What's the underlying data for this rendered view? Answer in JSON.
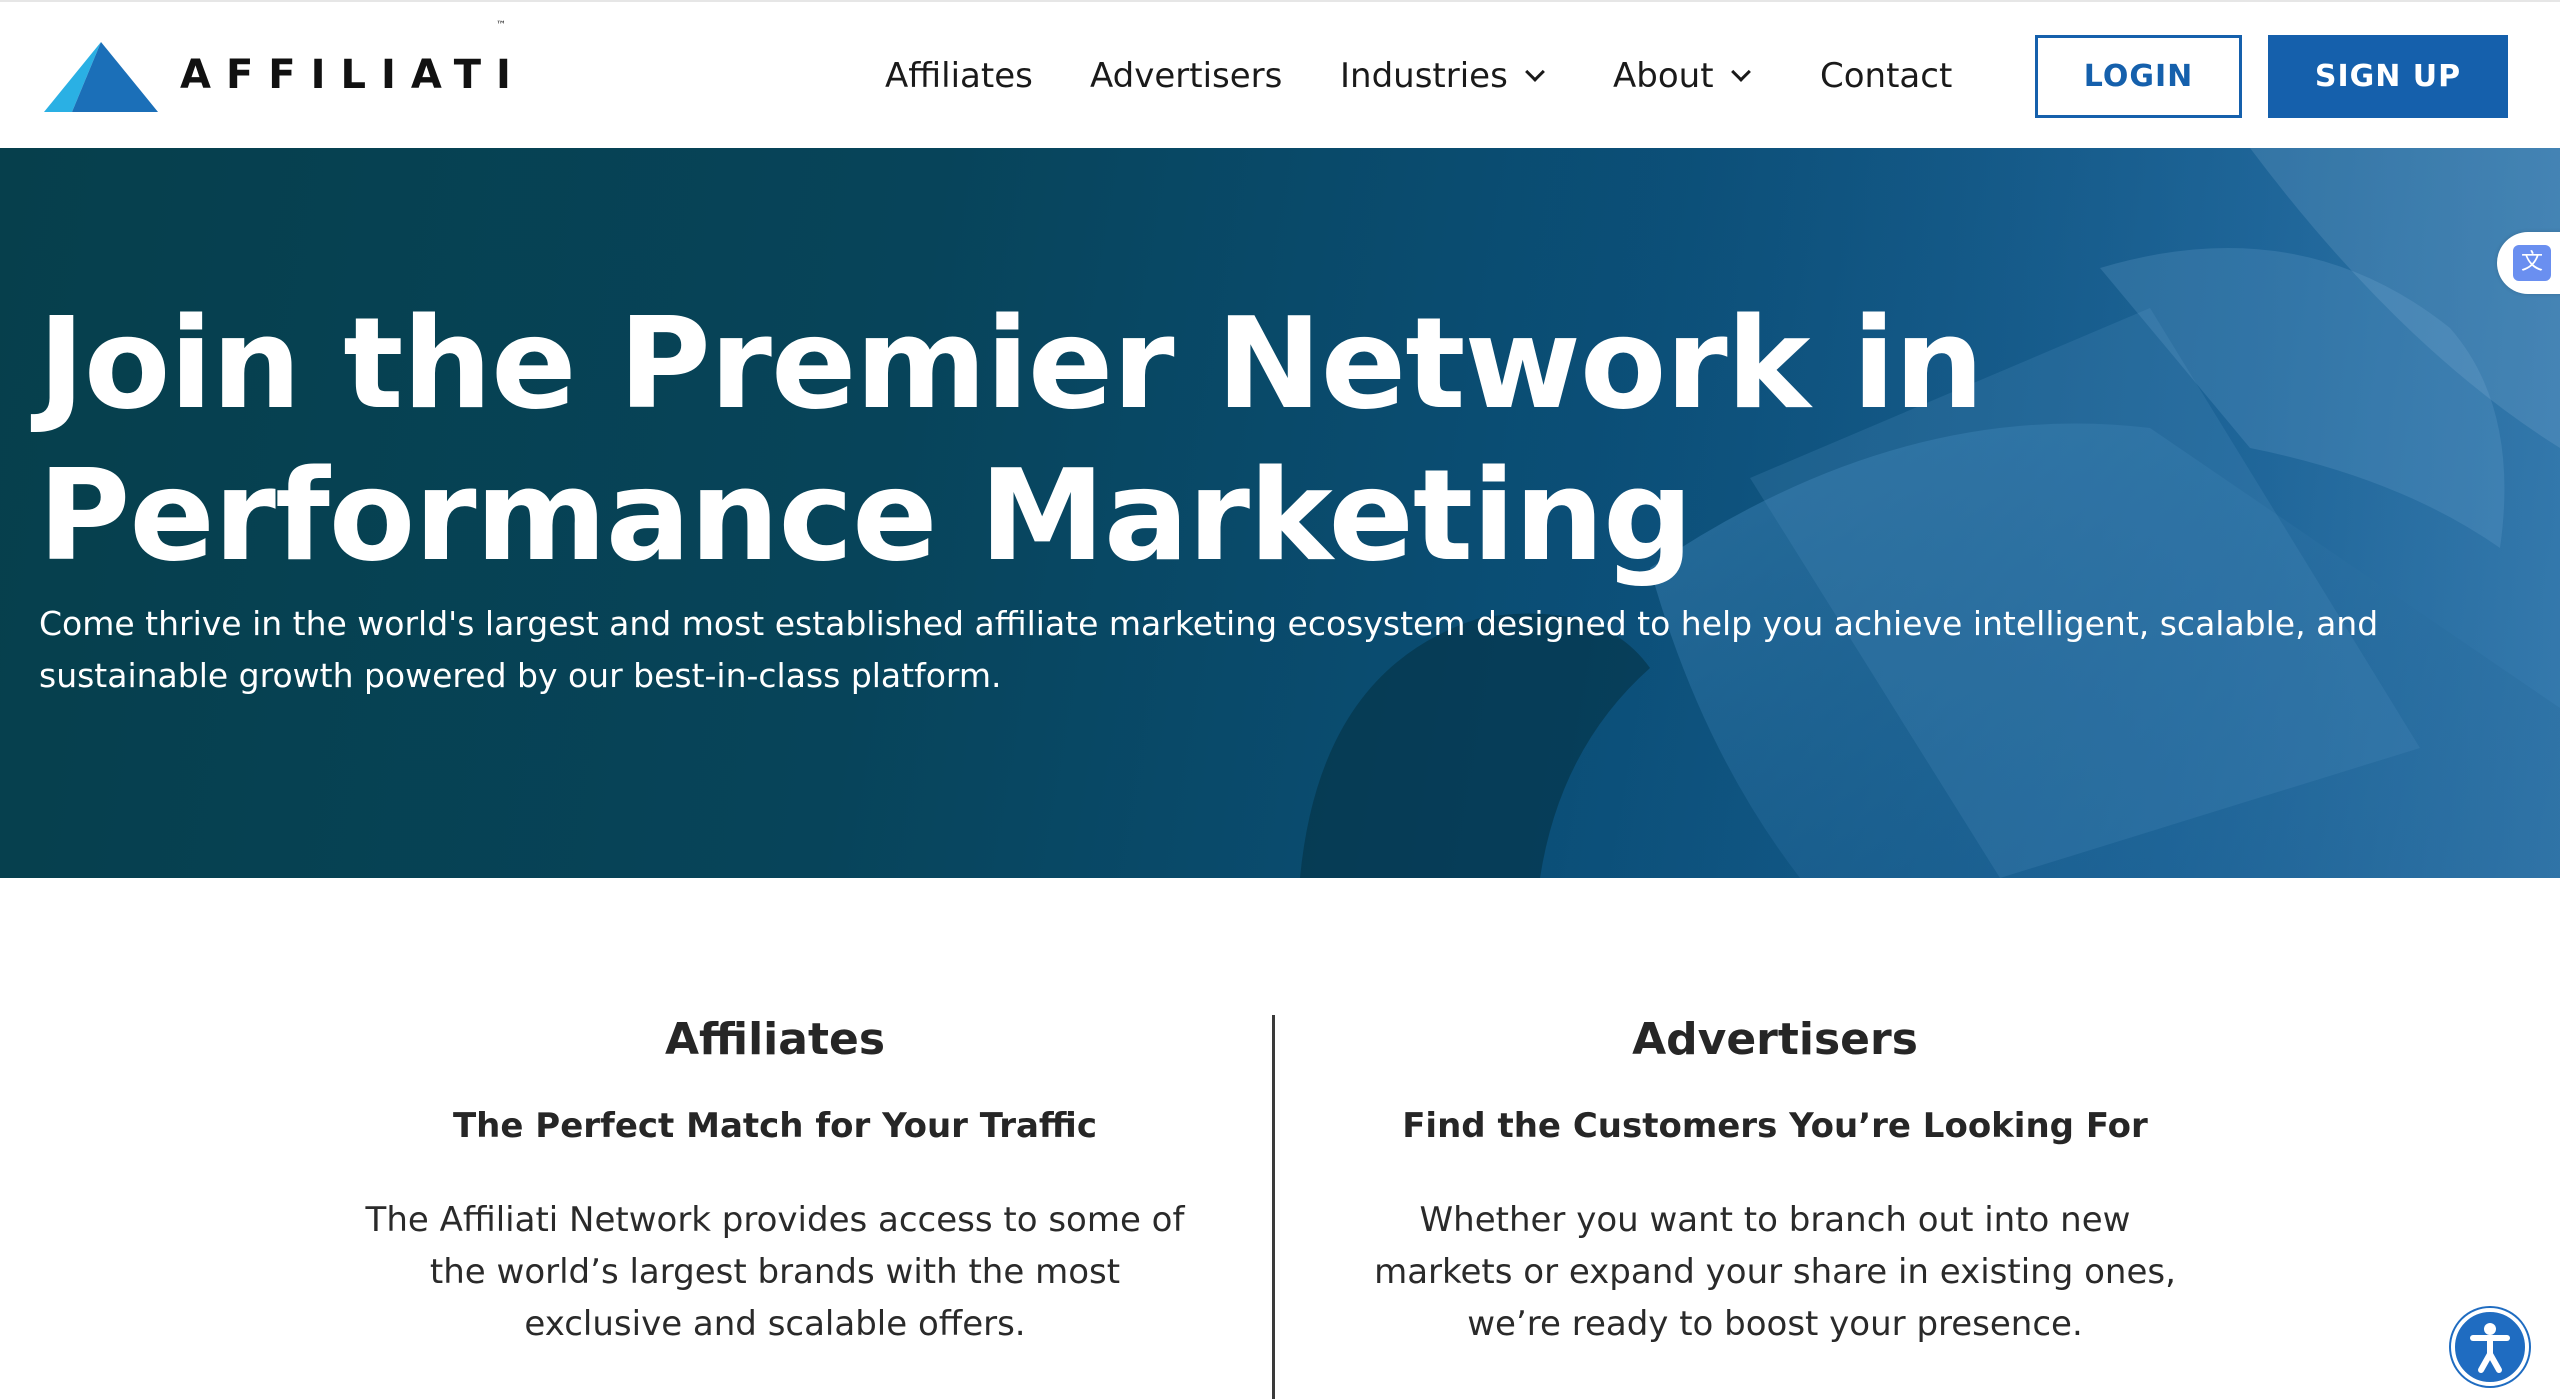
{
  "brand": {
    "name": "AFFILIATI",
    "trademark": "™",
    "logo_colors": {
      "light": "#2ab0e4",
      "dark": "#1b6fb8"
    }
  },
  "nav": {
    "items": [
      {
        "label": "Affiliates",
        "has_dropdown": false
      },
      {
        "label": "Advertisers",
        "has_dropdown": false
      },
      {
        "label": "Industries",
        "has_dropdown": true
      },
      {
        "label": "About",
        "has_dropdown": true
      },
      {
        "label": "Contact",
        "has_dropdown": false
      }
    ],
    "login_label": "LOGIN",
    "signup_label": "SIGN UP"
  },
  "hero": {
    "title_line1": "Join the Premier Network in",
    "title_line2": "Performance Marketing",
    "subtitle": "Come thrive in the world's largest and most established affiliate marketing ecosystem designed to help you achieve intelligent, scalable, and sustainable growth powered by our best-in-class platform."
  },
  "sections": {
    "affiliates": {
      "heading": "Affiliates",
      "subheading": "The Perfect Match for Your Traffic",
      "body": "The Affiliati Network provides access to some of the world’s largest brands with the most exclusive and scalable offers."
    },
    "advertisers": {
      "heading": "Advertisers",
      "subheading": "Find the Customers You’re Looking For",
      "body": "Whether you want to branch out into new markets or expand your share in existing ones, we’re ready to boost your presence."
    }
  },
  "widgets": {
    "translate_icon": "translate-icon",
    "accessibility_icon": "accessibility-icon"
  },
  "colors": {
    "primary": "#1560ac",
    "hero_dark": "#063f4c",
    "hero_light": "#2a6ea3",
    "text": "#1c1c1c"
  }
}
